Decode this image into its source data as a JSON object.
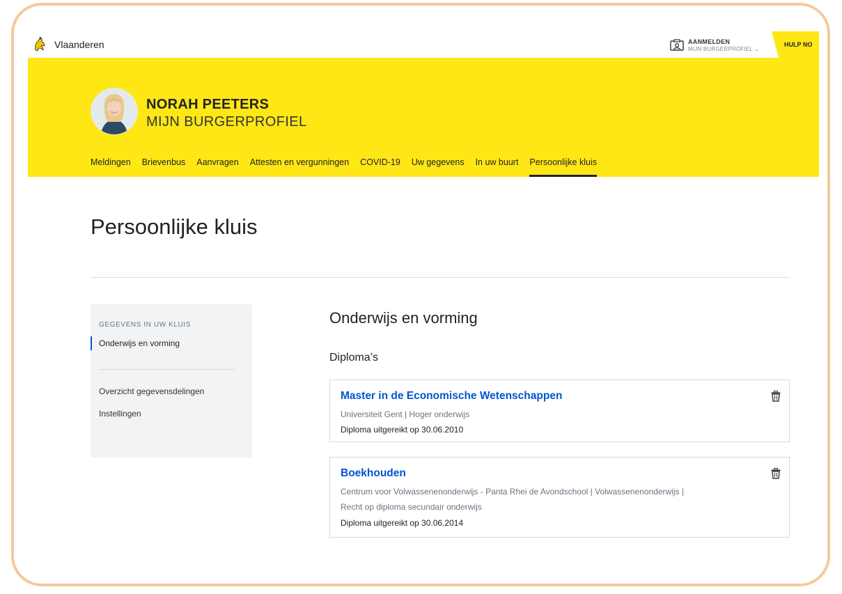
{
  "topbar": {
    "brand": "Vlaanderen",
    "login_title": "AANMELDEN",
    "login_subtitle": "MIJN BURGERPROFIEL ⌄",
    "help_label": "HULP NO"
  },
  "header": {
    "name": "NORAH PEETERS",
    "profile": "MIJN BURGERPROFIEL"
  },
  "nav": {
    "items": [
      {
        "label": "Meldingen"
      },
      {
        "label": "Brievenbus"
      },
      {
        "label": "Aanvragen"
      },
      {
        "label": "Attesten en vergunningen"
      },
      {
        "label": "COVID-19"
      },
      {
        "label": "Uw gegevens"
      },
      {
        "label": "In uw buurt"
      },
      {
        "label": "Persoonlijke kluis"
      }
    ],
    "active_index": 7
  },
  "page": {
    "title": "Persoonlijke kluis"
  },
  "sidebar": {
    "heading": "GEGEVENS IN UW KLUIS",
    "active_item": "Onderwijs en vorming",
    "links": [
      "Overzicht gegevensdelingen",
      "Instellingen"
    ]
  },
  "main": {
    "section_title": "Onderwijs en vorming",
    "subsection_title": "Diploma’s",
    "diplomas": [
      {
        "title": "Master in de Economische Wetenschappen",
        "line1": "Universiteit Gent | Hoger onderwijs",
        "line2": "",
        "date": "Diploma uitgereikt op 30.06.2010"
      },
      {
        "title": "Boekhouden",
        "line1": "Centrum voor Volwassenenonderwijs - Panta Rhei de Avondschool | Volwassenenonderwijs |",
        "line2": "Recht op diploma secundair onderwijs",
        "date": "Diploma uitgereikt op 30.06.2014"
      }
    ]
  },
  "colors": {
    "header_yellow": "#ffe615",
    "link_blue": "#0055cc",
    "frame_border": "#f5c99a"
  }
}
